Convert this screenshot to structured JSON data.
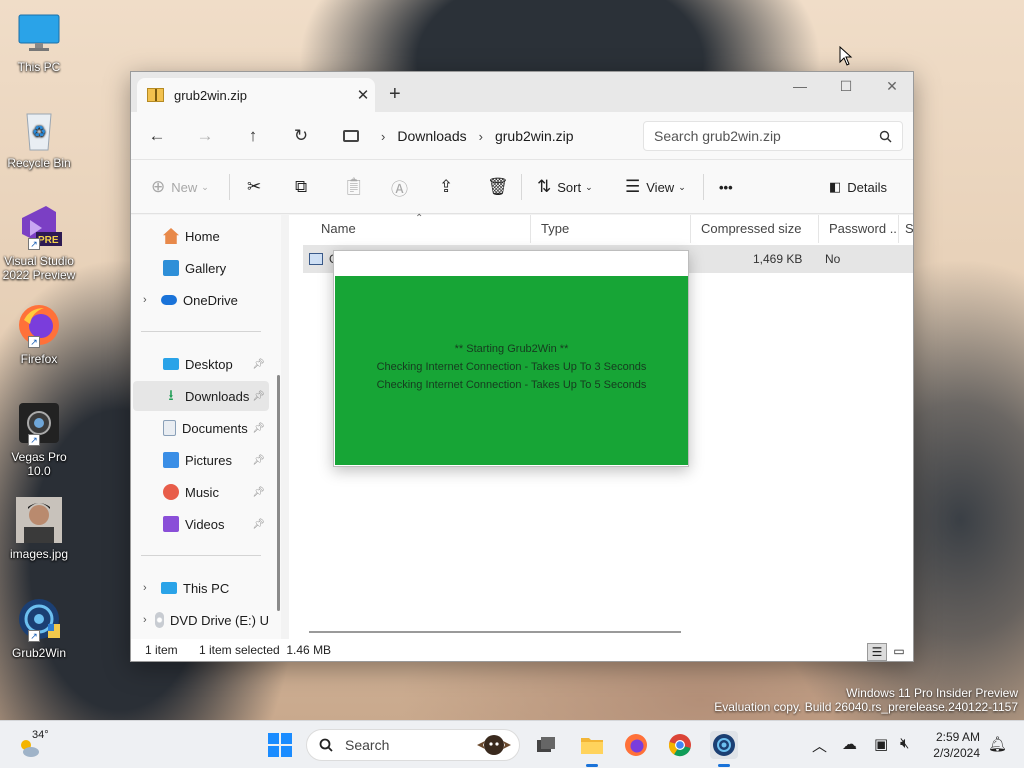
{
  "desktop": {
    "icons": [
      {
        "label": "This PC"
      },
      {
        "label": "Recycle Bin"
      },
      {
        "label": "Visual Studio 2022 Preview",
        "badge": "PRE"
      },
      {
        "label": "Firefox"
      },
      {
        "label": "Vegas Pro 10.0"
      },
      {
        "label": "images.jpg"
      },
      {
        "label": "Grub2Win"
      }
    ],
    "watermark": {
      "line1": "Windows 11 Pro Insider Preview",
      "line2": "Evaluation copy. Build 26040.rs_prerelease.240122-1157"
    }
  },
  "explorer": {
    "tab_title": "grub2win.zip",
    "tab_close": "✕",
    "new_tab": "+",
    "window_controls": {
      "minimize": "—",
      "maximize": "☐",
      "close": "✕"
    },
    "breadcrumb": [
      "Downloads",
      "grub2win.zip"
    ],
    "search_placeholder": "Search grub2win.zip",
    "toolbar": {
      "new": "New",
      "sort": "Sort",
      "view": "View",
      "more": "•••",
      "details": "Details"
    },
    "nav": {
      "home": "Home",
      "gallery": "Gallery",
      "onedrive": "OneDrive",
      "desktop": "Desktop",
      "downloads": "Downloads",
      "documents": "Documents",
      "pictures": "Pictures",
      "music": "Music",
      "videos": "Videos",
      "this_pc": "This PC",
      "dvd": "DVD Drive (E:) U"
    },
    "columns": [
      "Name",
      "Type",
      "Compressed size",
      "Password ...",
      "Si"
    ],
    "row": {
      "name": "G",
      "compressed_size": "1,469 KB",
      "password": "No"
    },
    "status": {
      "count": "1 item",
      "selection": "1 item selected  1.46 MB"
    }
  },
  "grub2win_dialog": {
    "lines": [
      "** Starting Grub2Win **",
      "Checking Internet Connection - Takes Up To 3 Seconds",
      "Checking Internet Connection - Takes Up To 5 Seconds"
    ],
    "background_color": "#17a536"
  },
  "taskbar": {
    "weather_temp": "34°",
    "search_label": "Search",
    "time": "2:59 AM",
    "date": "2/3/2024"
  }
}
